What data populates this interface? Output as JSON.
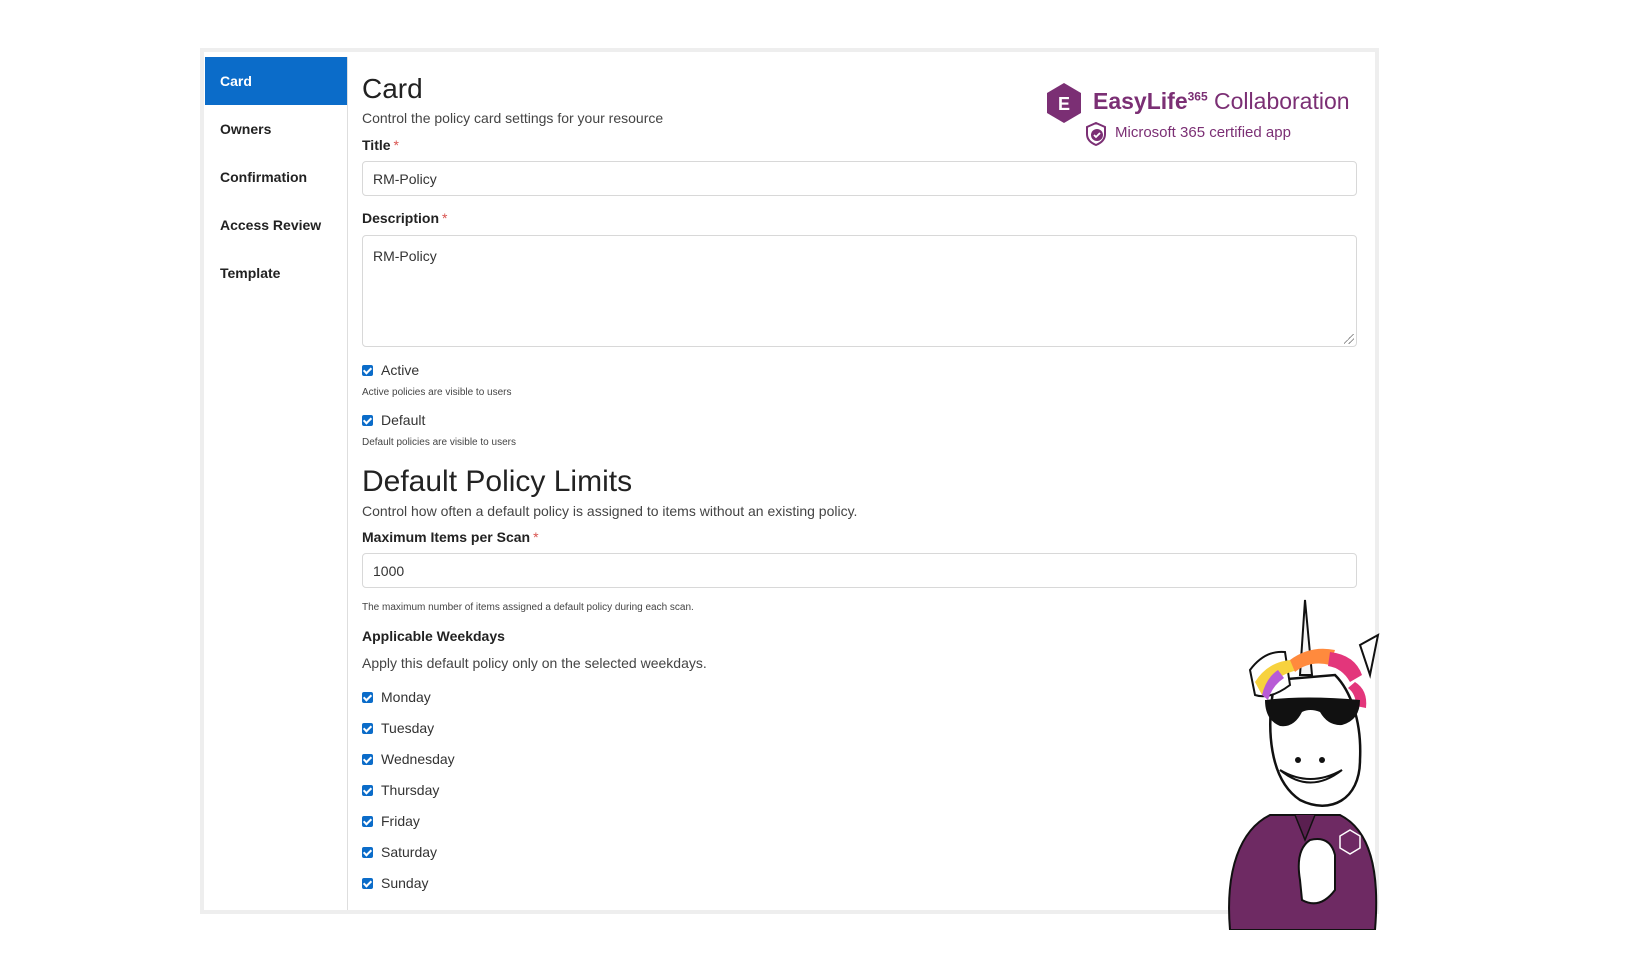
{
  "sidebar": {
    "items": [
      {
        "label": "Card",
        "active": true
      },
      {
        "label": "Owners",
        "active": false
      },
      {
        "label": "Confirmation",
        "active": false
      },
      {
        "label": "Access Review",
        "active": false
      },
      {
        "label": "Template",
        "active": false
      }
    ]
  },
  "card": {
    "title": "Card",
    "subtitle": "Control the policy card settings for your resource",
    "title_label": "Title",
    "title_value": "RM-Policy",
    "description_label": "Description",
    "description_value": "RM-Policy",
    "active_label": "Active",
    "active_checked": true,
    "active_help": "Active policies are visible to users",
    "default_label": "Default",
    "default_checked": true,
    "default_help": "Default policies are visible to users",
    "required_marker": "*"
  },
  "limits": {
    "heading": "Default Policy Limits",
    "subtitle": "Control how often a default policy is assigned to items without an existing policy.",
    "max_items_label": "Maximum Items per Scan",
    "max_items_value": "1000",
    "max_items_help": "The maximum number of items assigned a default policy during each scan.",
    "weekdays_label": "Applicable Weekdays",
    "weekdays_help": "Apply this default policy only on the selected weekdays.",
    "weekdays": [
      {
        "label": "Monday",
        "checked": true
      },
      {
        "label": "Tuesday",
        "checked": true
      },
      {
        "label": "Wednesday",
        "checked": true
      },
      {
        "label": "Thursday",
        "checked": true
      },
      {
        "label": "Friday",
        "checked": true
      },
      {
        "label": "Saturday",
        "checked": true
      },
      {
        "label": "Sunday",
        "checked": true
      }
    ]
  },
  "branding": {
    "logo_letter": "E",
    "product_name": "EasyLife",
    "product_sup": "365",
    "product_suffix": "Collaboration",
    "certified_text": "Microsoft 365 certified app",
    "brand_color": "#7b2f74",
    "accent_color": "#0b6cc9"
  }
}
